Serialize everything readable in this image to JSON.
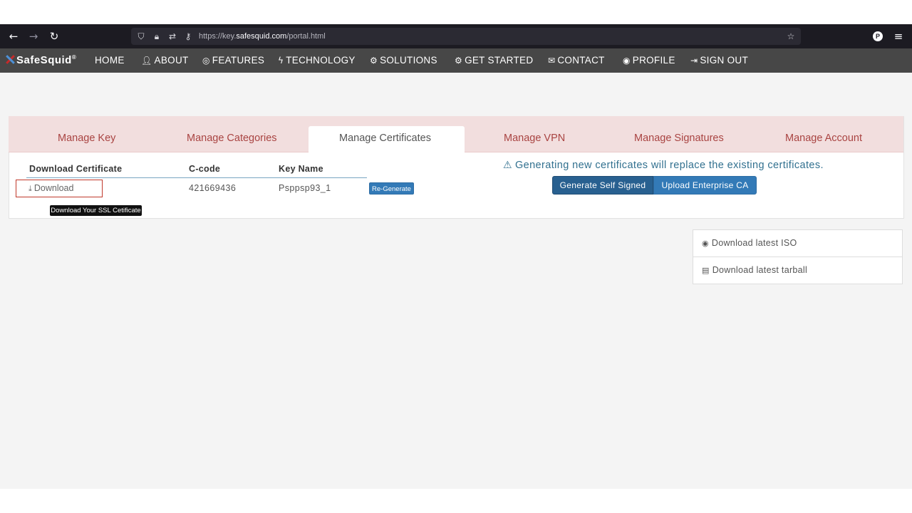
{
  "browser": {
    "url_prefix": "https://key.",
    "url_host": "safesquid.com",
    "url_path": "/portal.html",
    "profile_initial": "P"
  },
  "navbar": {
    "brand": "SafeSquid",
    "brand_mark": "®",
    "items": [
      {
        "label": "HOME",
        "icon": ""
      },
      {
        "label": "ABOUT",
        "icon": "user-icon"
      },
      {
        "label": "FEATURES",
        "icon": "target-icon"
      },
      {
        "label": "TECHNOLOGY",
        "icon": "bolt-icon"
      },
      {
        "label": "SOLUTIONS",
        "icon": "gears-icon"
      },
      {
        "label": "GET STARTED",
        "icon": "gears-icon"
      },
      {
        "label": "CONTACT",
        "icon": "envelope-icon"
      },
      {
        "label": "PROFILE",
        "icon": "user-circle-icon"
      },
      {
        "label": "SIGN OUT",
        "icon": "sign-out-icon"
      }
    ]
  },
  "tabs": [
    {
      "label": "Manage Key"
    },
    {
      "label": "Manage Categories"
    },
    {
      "label": "Manage Certificates",
      "active": true
    },
    {
      "label": "Manage VPN"
    },
    {
      "label": "Manage Signatures"
    },
    {
      "label": "Manage Account"
    }
  ],
  "certificates": {
    "headers": [
      "Download Certificate",
      "C-code",
      "Key Name"
    ],
    "row": {
      "download_label": "Download",
      "ccode": "421669436",
      "key_name": "Psppsp93_1",
      "regenerate_label": "Re-Generate"
    },
    "tooltip": "Download Your SSL Cetificate",
    "warning": "Generating new certificates will replace the existing certificates.",
    "generate_label": "Generate Self Signed",
    "upload_label": "Upload Enterprise CA"
  },
  "downloads": [
    {
      "label": "Download latest ISO",
      "icon": "disc-icon"
    },
    {
      "label": "Download latest tarball",
      "icon": "file-icon"
    }
  ],
  "colors": {
    "tab_bar": "#f2dede",
    "tab_text": "#a94442",
    "primary": "#337ab7",
    "primary_dark": "#286090",
    "warning_text": "#31708f",
    "navbar": "#474747"
  }
}
